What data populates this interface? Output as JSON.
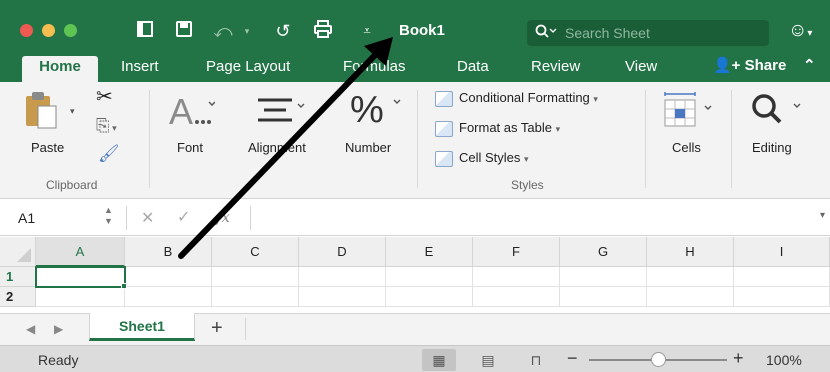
{
  "window": {
    "title": "Book1",
    "search_placeholder": "Search Sheet",
    "traffic_colors": [
      "#ee5a52",
      "#f5bd4f",
      "#5fc454"
    ],
    "toolbar_icons": [
      "sidebar-icon",
      "save-icon",
      "undo-icon",
      "redo-icon",
      "print-icon",
      "customize-toolbar-icon"
    ],
    "accent": "#227447"
  },
  "tabs": [
    {
      "label": "Home",
      "active": true
    },
    {
      "label": "Insert"
    },
    {
      "label": "Page Layout"
    },
    {
      "label": "Formulas"
    },
    {
      "label": "Data"
    },
    {
      "label": "Review"
    },
    {
      "label": "View"
    }
  ],
  "share_label": "Share",
  "ribbon": {
    "clipboard": {
      "paste_label": "Paste",
      "group_label": "Clipboard"
    },
    "font_label": "Font",
    "alignment_label": "Alignment",
    "number_label": "Number",
    "styles": {
      "items": [
        "Conditional Formatting",
        "Format as Table",
        "Cell Styles"
      ],
      "group_label": "Styles"
    },
    "cells_label": "Cells",
    "editing_label": "Editing"
  },
  "formula_bar": {
    "name_box": "A1",
    "fx": "fx",
    "value": ""
  },
  "grid": {
    "columns": [
      "A",
      "B",
      "C",
      "D",
      "E",
      "F",
      "G",
      "H",
      "I"
    ],
    "rows": [
      "1",
      "2"
    ],
    "selected_cell": "A1"
  },
  "sheet_tabs": [
    {
      "label": "Sheet1",
      "active": true
    }
  ],
  "status": {
    "text": "Ready",
    "zoom": "100%",
    "zoom_fraction": 0.5,
    "view_modes": [
      "normal-view-icon",
      "page-layout-view-icon",
      "page-break-view-icon"
    ],
    "active_view": 0
  }
}
